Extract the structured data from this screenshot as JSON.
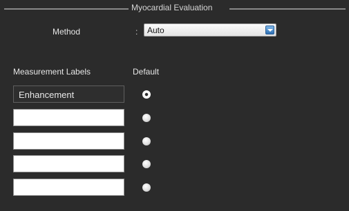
{
  "group": {
    "title": "Myocardial Evaluation"
  },
  "method": {
    "label": "Method",
    "separator": ":",
    "selected": "Auto"
  },
  "table": {
    "col_labels": "Measurement Labels",
    "col_default": "Default",
    "rows": [
      {
        "label": "Enhancement",
        "default": true
      },
      {
        "label": "",
        "default": false
      },
      {
        "label": "",
        "default": false
      },
      {
        "label": "",
        "default": false
      },
      {
        "label": "",
        "default": false
      }
    ]
  },
  "colors": {
    "panel_bg": "#2b2b2b",
    "accent": "#2c6fb4"
  },
  "icons": {
    "dropdown": "chevron-down-icon"
  }
}
